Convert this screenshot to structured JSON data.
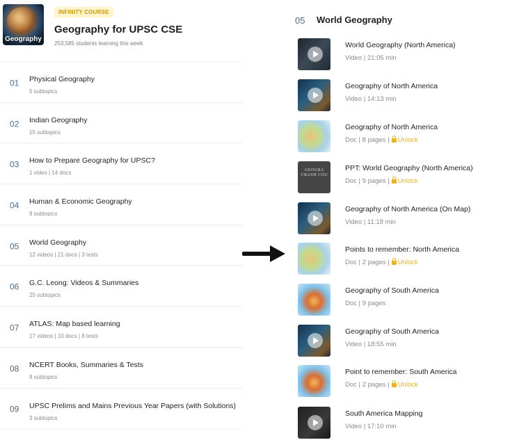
{
  "course": {
    "thumb_label": "Geography",
    "badge": "INFINITY COURSE",
    "title": "Geography for UPSC CSE",
    "learners": "253,585 students learning this week"
  },
  "topics": [
    {
      "num": "01",
      "title": "Physical Geography",
      "sub": "5 subtopics"
    },
    {
      "num": "02",
      "title": "Indian Geography",
      "sub": "15 subtopics"
    },
    {
      "num": "03",
      "title": "How to Prepare Geography for UPSC?",
      "sub": "1 video | 14 docs"
    },
    {
      "num": "04",
      "title": "Human & Economic Geography",
      "sub": "9 subtopics"
    },
    {
      "num": "05",
      "title": "World Geography",
      "sub": "12 videos | 21 docs | 3 tests"
    },
    {
      "num": "06",
      "title": "G.C. Leong: Videos & Summaries",
      "sub": "25 subtopics"
    },
    {
      "num": "07",
      "title": "ATLAS: Map based learning",
      "sub": "17 videos | 10 docs | 8 tests"
    },
    {
      "num": "08",
      "title": "NCERT Books, Summaries & Tests",
      "sub": "9 subtopics"
    },
    {
      "num": "09",
      "title": "UPSC Prelims and Mains Previous Year Papers (with Solutions)",
      "sub": "3 subtopics"
    }
  ],
  "section": {
    "num": "05",
    "title": "World Geography"
  },
  "items": [
    {
      "title": "World Geography (North America)",
      "meta": "Video | 21:05 min",
      "unlock": "",
      "icon": "video-thumb"
    },
    {
      "title": "Geography of North America",
      "meta": "Video | 14:13 min",
      "unlock": "",
      "icon": "video-thumb"
    },
    {
      "title": "Geography of North America",
      "meta": "Doc | 8 pages |",
      "unlock": "Unlock",
      "icon": "map-thumb"
    },
    {
      "title": "PPT: World Geography (North America)",
      "meta": "Doc | 9 pages |",
      "unlock": "Unlock",
      "icon": "ppt-thumb",
      "thumb_text": "GEOGRA CRASH COU"
    },
    {
      "title": "Geography of North America (On Map)",
      "meta": "Video | 11:18 min",
      "unlock": "",
      "icon": "video-thumb"
    },
    {
      "title": "Points to remember: North America",
      "meta": "Doc | 2 pages |",
      "unlock": "Unlock",
      "icon": "map-thumb"
    },
    {
      "title": "Geography of South America",
      "meta": "Doc | 9 pages",
      "unlock": "",
      "icon": "map-thumb"
    },
    {
      "title": "Geography of South America",
      "meta": "Video | 18:55 min",
      "unlock": "",
      "icon": "video-thumb"
    },
    {
      "title": "Point to remember: South America",
      "meta": "Doc | 2 pages |",
      "unlock": "Unlock",
      "icon": "map-thumb"
    },
    {
      "title": "South America Mapping",
      "meta": "Video | 17:10 min",
      "unlock": "",
      "icon": "video-thumb"
    }
  ],
  "colors": {
    "accent_unlock": "#e5b324",
    "number": "#4a6a8a",
    "badge_bg": "#fff4cc"
  }
}
